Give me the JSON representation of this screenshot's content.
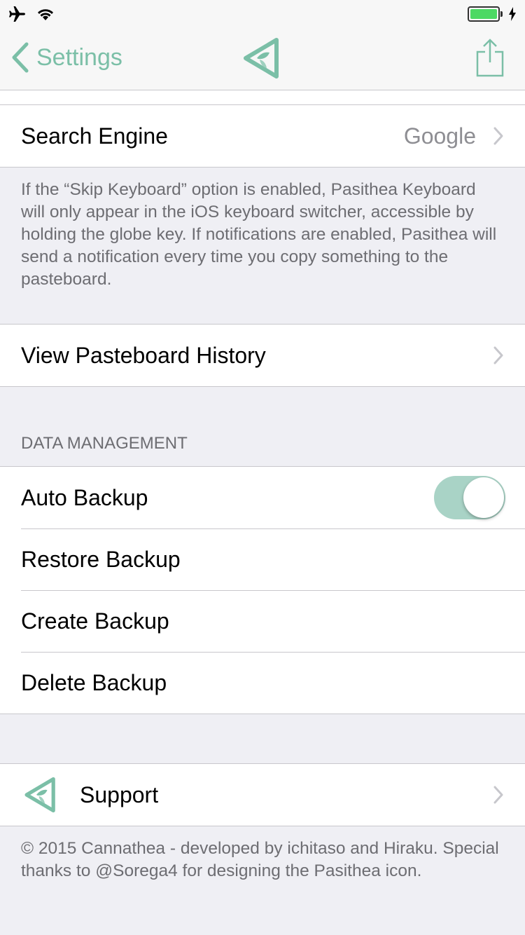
{
  "navbar": {
    "back_label": "Settings"
  },
  "colors": {
    "accent": "#7bbfa7",
    "toggle_on": "#a9d3c6",
    "battery": "#4cd964"
  },
  "search_engine": {
    "label": "Search Engine",
    "value": "Google"
  },
  "keyboard_footer": "If the “Skip Keyboard” option is enabled, Pasithea Keyboard will only appear in the iOS keyboard switcher, accessible by holding the globe key. If notifications are enabled, Pasithea will send a notification every time you copy something to the pasteboard.",
  "history": {
    "label": "View Pasteboard History"
  },
  "data_management": {
    "header": "DATA MANAGEMENT",
    "auto_backup_label": "Auto Backup",
    "auto_backup_on": true,
    "restore_label": "Restore Backup",
    "create_label": "Create Backup",
    "delete_label": "Delete Backup"
  },
  "support": {
    "label": "Support"
  },
  "copyright": "© 2015 Cannathea - developed by ichitaso and Hiraku. Special thanks to @Sorega4 for designing the Pasithea icon."
}
